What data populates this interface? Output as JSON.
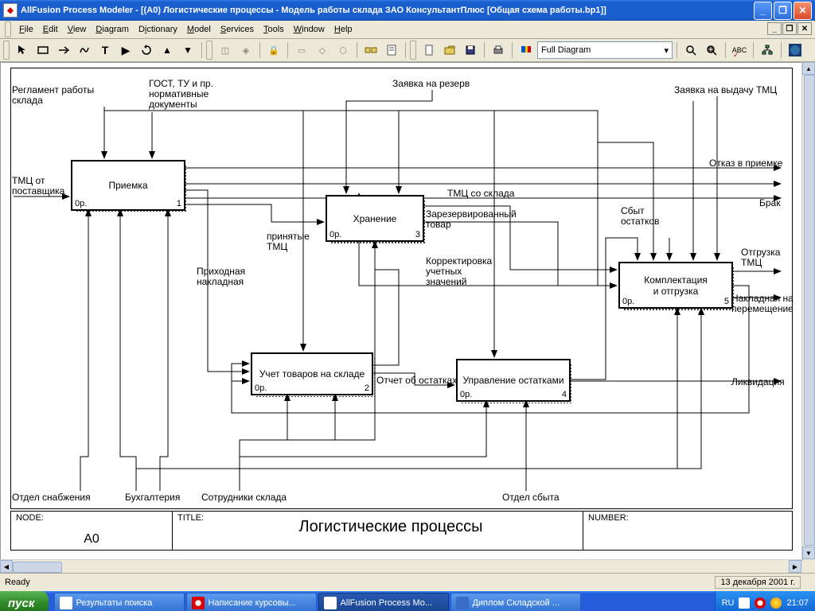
{
  "window": {
    "title": "AllFusion Process Modeler  - [(A0) Логистические процессы   - Модель работы склада ЗАО КонсультантПлюс  [Общая схема работы.bp1]]"
  },
  "menu": {
    "file": "File",
    "edit": "Edit",
    "view": "View",
    "diagram": "Diagram",
    "dictionary": "Dictionary",
    "model": "Model",
    "services": "Services",
    "tools": "Tools",
    "window": "Window",
    "help": "Help"
  },
  "toolbar": {
    "combo": "Full Diagram"
  },
  "status": {
    "ready": "Ready",
    "date": "13 декабря 2001 г."
  },
  "taskbar": {
    "start": "пуск",
    "btn1": "Результаты поиска",
    "btn2": "Написание курсовы...",
    "btn3": "AllFusion Process Mo...",
    "btn4": "Диплом Складской ...",
    "lang": "RU",
    "clock": "21:07"
  },
  "diagram": {
    "node_label": "NODE:",
    "node_value": "A0",
    "title_label": "TITLE:",
    "title_value": "Логистические процессы",
    "number_label": "NUMBER:",
    "boxes": {
      "b1": {
        "name": "Приемка",
        "bl": "0р.",
        "br": "1"
      },
      "b2": {
        "name": "Учет товаров на складе",
        "bl": "0р.",
        "br": "2"
      },
      "b3": {
        "name": "Хранение",
        "bl": "0р.",
        "br": "3"
      },
      "b4": {
        "name": "Управление остатками",
        "bl": "0р.",
        "br": "4"
      },
      "b5": {
        "name": "Комплектация и отгрузка",
        "bl": "0р.",
        "br": "5"
      }
    },
    "labels": {
      "reglament": "Регламент работы\nсклада",
      "gost": "ГОСТ, ТУ и пр.\nнормативные\nдокументы",
      "zayavka_rezerv": "Заявка на резерв",
      "zayavka_tmc": "Заявка на выдачу ТМЦ",
      "tmc_post": "ТМЦ от\nпоставщика",
      "otkaz": "Отказ в приемке",
      "brak": "Брак",
      "tmc_sklad": "ТМЦ со склада",
      "prinyatye": "принятые\nТМЦ",
      "prihodnaya": "Приходная\nнакладная",
      "zarezerv": "Зарезервированный\nтовар",
      "korrekt": "Корректировка\nучетных\nзначений",
      "sbyt_ost": "Сбыт\nостатков",
      "otgruzka_tmc": "Отгрузка\nТМЦ",
      "nakladnaya": "Накладная на\nперемещение",
      "likvidacia": "Ликвидация",
      "otchet": "Отчет об остатках",
      "otdel_snab": "Отдел снабжения",
      "buhg": "Бухгалтерия",
      "sotr": "Сотрудники склада",
      "otdel_sbyt": "Отдел сбыта"
    }
  }
}
